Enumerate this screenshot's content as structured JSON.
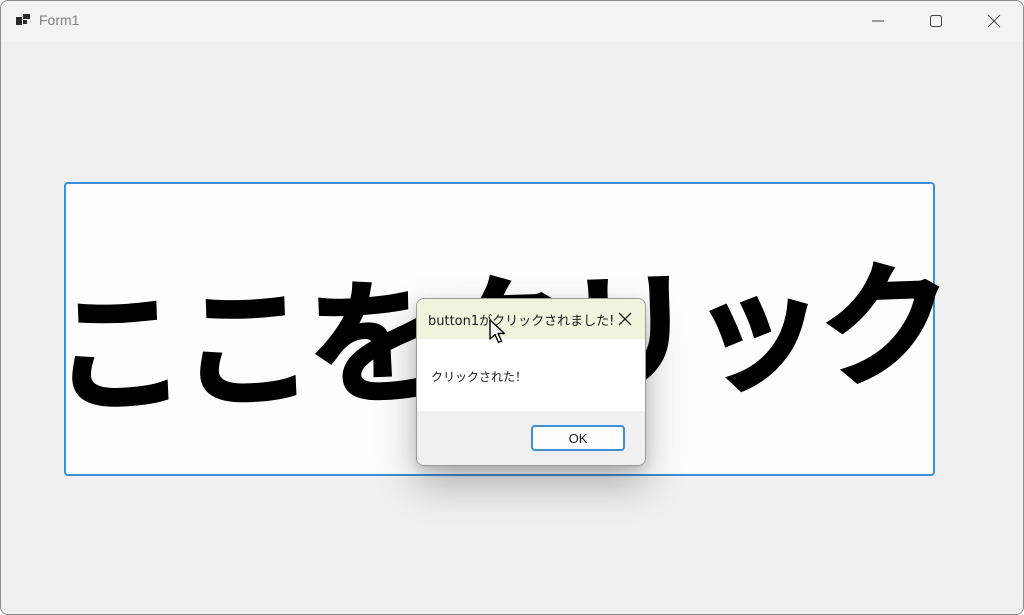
{
  "window": {
    "title": "Form1",
    "icon": "app-window-icon",
    "controls": [
      "minimize-icon",
      "maximize-icon",
      "close-icon"
    ]
  },
  "main": {
    "button_label": "ここをクリック",
    "accent_color": "#3a8fd8"
  },
  "dialog": {
    "title": "button1がクリックされました!",
    "message": "クリックされた！",
    "ok_label": "OK",
    "title_bg_color": "#eef5dc"
  },
  "cursor": {
    "icon": "pointer-cursor-icon"
  }
}
